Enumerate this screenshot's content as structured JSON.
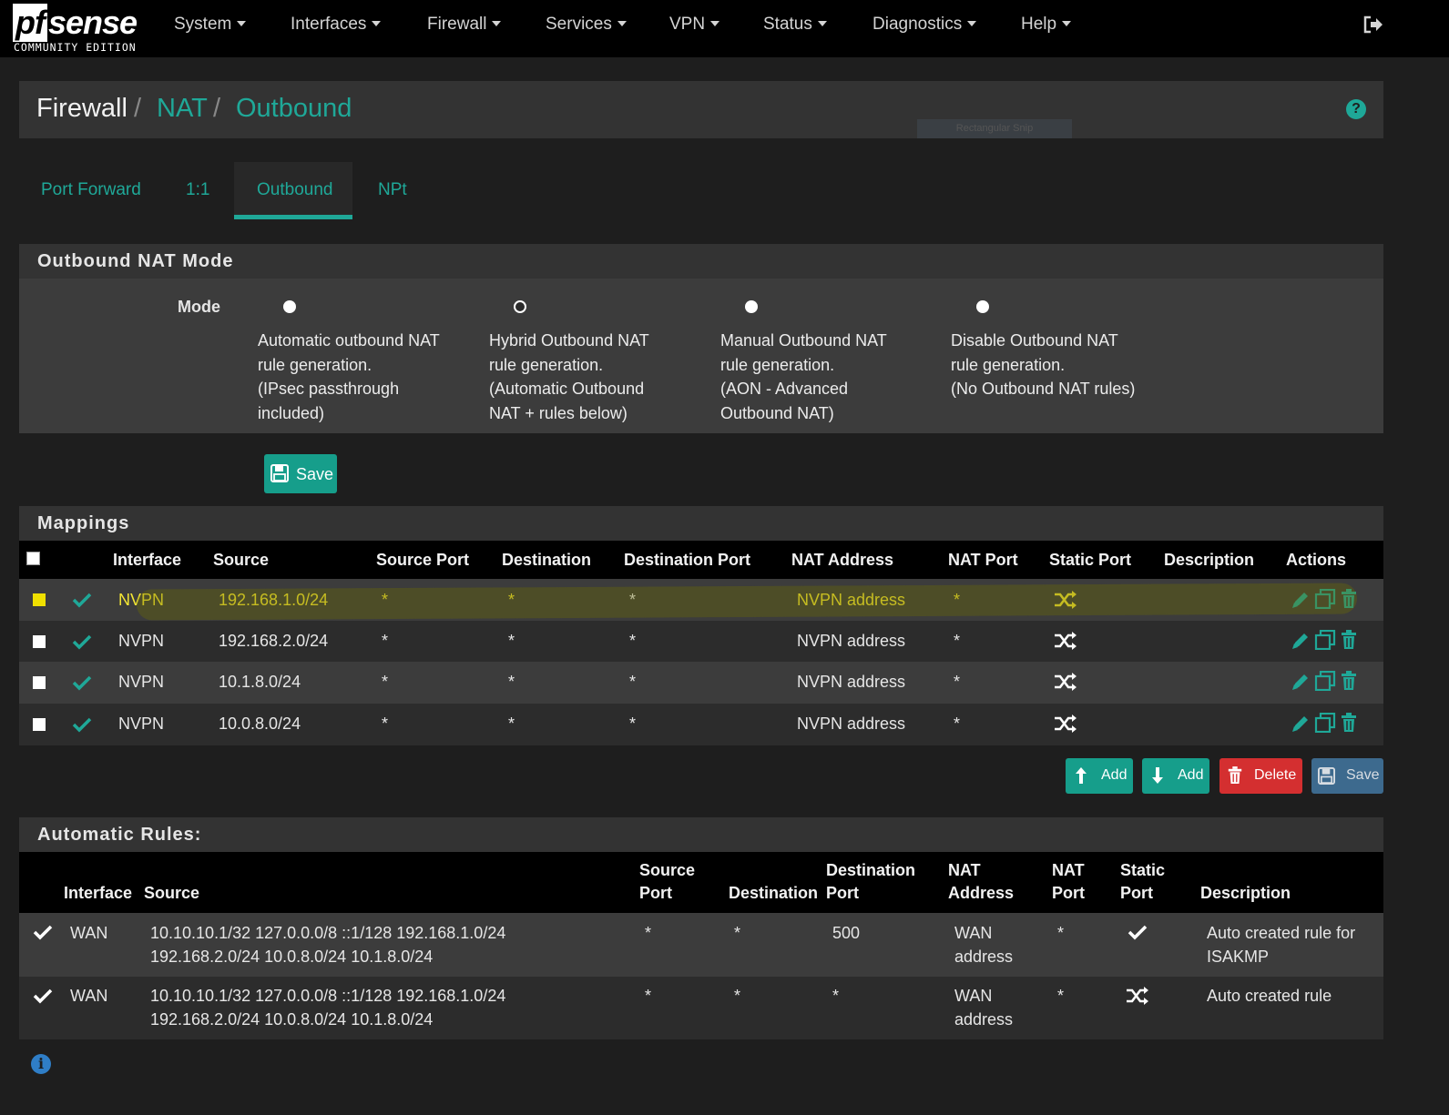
{
  "brand": {
    "logo_pf": "pf",
    "logo_sense": "sense",
    "edition": "COMMUNITY EDITION"
  },
  "nav": [
    "System",
    "Interfaces",
    "Firewall",
    "Services",
    "VPN",
    "Status",
    "Diagnostics",
    "Help"
  ],
  "breadcrumb": {
    "root": "Firewall",
    "sep": "/",
    "mid": "NAT",
    "current": "Outbound"
  },
  "snip_overlay": "Rectangular Snip",
  "tabs": [
    "Port Forward",
    "1:1",
    "Outbound",
    "NPt"
  ],
  "active_tab": "Outbound",
  "mode_panel": {
    "title": "Outbound NAT Mode",
    "label": "Mode",
    "selected": 1,
    "options": [
      [
        "Automatic outbound NAT",
        "rule generation.",
        "(IPsec passthrough",
        "included)"
      ],
      [
        "Hybrid Outbound NAT",
        "rule generation.",
        "(Automatic Outbound",
        "NAT + rules below)"
      ],
      [
        "Manual Outbound NAT",
        "rule generation.",
        "(AON - Advanced",
        "Outbound NAT)"
      ],
      [
        "Disable Outbound NAT",
        "rule generation.",
        "(No Outbound NAT rules)"
      ]
    ],
    "save_label": "Save"
  },
  "mappings": {
    "title": "Mappings",
    "headers": [
      "Interface",
      "Source",
      "Source Port",
      "Destination",
      "Destination Port",
      "NAT Address",
      "NAT Port",
      "Static Port",
      "Description",
      "Actions"
    ],
    "rows": [
      {
        "interface": "NVPN",
        "source": "192.168.1.0/24",
        "source_port": "*",
        "destination": "*",
        "destination_port": "*",
        "nat_address": "NVPN address",
        "nat_port": "*",
        "description": "",
        "selected": true
      },
      {
        "interface": "NVPN",
        "source": "192.168.2.0/24",
        "source_port": "*",
        "destination": "*",
        "destination_port": "*",
        "nat_address": "NVPN address",
        "nat_port": "*",
        "description": "",
        "selected": false
      },
      {
        "interface": "NVPN",
        "source": "10.1.8.0/24",
        "source_port": "*",
        "destination": "*",
        "destination_port": "*",
        "nat_address": "NVPN address",
        "nat_port": "*",
        "description": "",
        "selected": false
      },
      {
        "interface": "NVPN",
        "source": "10.0.8.0/24",
        "source_port": "*",
        "destination": "*",
        "destination_port": "*",
        "nat_address": "NVPN address",
        "nat_port": "*",
        "description": "",
        "selected": false
      }
    ],
    "buttons": {
      "add_top": "Add",
      "add_bottom": "Add",
      "delete": "Delete",
      "save": "Save"
    }
  },
  "automatic_rules": {
    "title": "Automatic Rules:",
    "headers": {
      "interface": "Interface",
      "source": "Source",
      "source_port": [
        "Source",
        "Port"
      ],
      "destination": "Destination",
      "destination_port": [
        "Destination",
        "Port"
      ],
      "nat_address": [
        "NAT",
        "Address"
      ],
      "nat_port": [
        "NAT",
        "Port"
      ],
      "static_port": [
        "Static",
        "Port"
      ],
      "description": "Description"
    },
    "rows": [
      {
        "interface": "WAN",
        "source": [
          "10.10.10.1/32 127.0.0.0/8 ::1/128 192.168.1.0/24",
          "192.168.2.0/24 10.0.8.0/24 10.1.8.0/24"
        ],
        "source_port": "*",
        "destination": "*",
        "destination_port": "500",
        "nat_address": [
          "WAN",
          "address"
        ],
        "nat_port": "*",
        "static_port": "check",
        "description": [
          "Auto created rule for",
          "ISAKMP"
        ]
      },
      {
        "interface": "WAN",
        "source": [
          "10.10.10.1/32 127.0.0.0/8 ::1/128 192.168.1.0/24",
          "192.168.2.0/24 10.0.8.0/24 10.1.8.0/24"
        ],
        "source_port": "*",
        "destination": "*",
        "destination_port": "*",
        "nat_address": [
          "WAN",
          "address"
        ],
        "nat_port": "*",
        "static_port": "shuffle",
        "description": [
          "Auto created rule"
        ]
      }
    ]
  },
  "colors": {
    "accent": "#1fa898",
    "danger": "#d42f30",
    "highlight_text": "#f4e634",
    "selected_checkbox": "#f0e000"
  }
}
